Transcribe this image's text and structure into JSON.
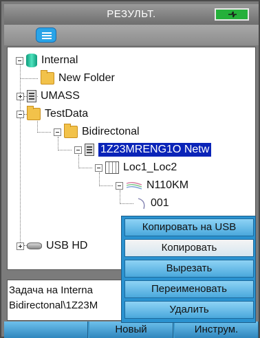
{
  "window": {
    "title": "РЕЗУЛЬТ."
  },
  "colors": {
    "battery": "#25b03a",
    "selection": "#0a24b8",
    "accent": "#2a92d0"
  },
  "icons": {
    "battery": "battery-plug-icon",
    "menu": "menu-icon"
  },
  "tree": {
    "nodes": [
      {
        "label": "Internal",
        "icon": "database-icon",
        "expander": "minus"
      },
      {
        "label": "New Folder",
        "icon": "folder-icon",
        "expander": "none"
      },
      {
        "label": "UMASS",
        "icon": "drive-icon",
        "expander": "plus"
      },
      {
        "label": "TestData",
        "icon": "folder-icon",
        "expander": "minus"
      },
      {
        "label": "Bidirectonal",
        "icon": "folder-icon",
        "expander": "minus"
      },
      {
        "label": "1Z23MRENG1O Netw",
        "icon": "drive-icon",
        "expander": "minus",
        "selected": true
      },
      {
        "label": "Loc1_Loc2",
        "icon": "location-icon",
        "expander": "minus"
      },
      {
        "label": "N110KM",
        "icon": "trace-icon",
        "expander": "minus"
      },
      {
        "label": "001",
        "icon": "curve-icon",
        "expander": "none"
      },
      {
        "label": "USB HD",
        "icon": "usb-drive-icon",
        "expander": "plus"
      }
    ]
  },
  "task": {
    "line1": "Задача на Interna",
    "line2": "Bidirectonal\\1Z23M"
  },
  "toolbar": {
    "btn_blank": "",
    "btn_new": "Новый",
    "btn_tools": "Инструм."
  },
  "context_menu": {
    "items": [
      {
        "label": "Копировать на USB"
      },
      {
        "label": "Копировать",
        "highlighted": true
      },
      {
        "label": "Вырезать"
      },
      {
        "label": "Переименовать"
      },
      {
        "label": "Удалить"
      }
    ]
  }
}
